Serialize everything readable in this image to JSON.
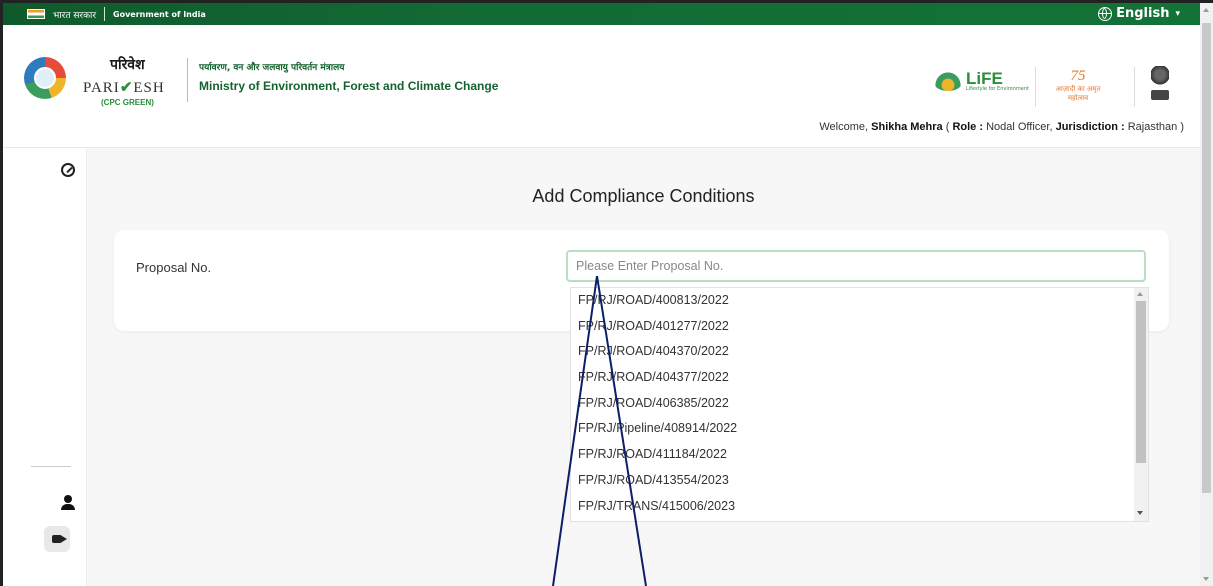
{
  "gov_bar": {
    "hindi": "भारत सरकार",
    "english": "Government of India",
    "language": "English"
  },
  "header": {
    "logo_hindi": "परिवेश",
    "logo_english_pre": "PARI",
    "logo_english_post": "ESH",
    "logo_sub": "(CPC GREEN)",
    "ministry_hindi": "पर्यावरण, वन और जलवायु परिवर्तन मंत्रालय",
    "ministry_english": "Ministry of Environment, Forest and Climate Change",
    "life_brand": "LiFE",
    "life_tagline": "Lifestyle for Environment",
    "azadi_number": "75",
    "azadi_text": "आज़ादी का अमृत महोत्सव",
    "welcome_prefix": "Welcome,",
    "user_name": "Shikha Mehra",
    "role_label": "Role :",
    "role_value": "Nodal Officer,",
    "jurisdiction_label": "Jurisdiction :",
    "jurisdiction_value": "Rajasthan"
  },
  "main": {
    "title": "Add Compliance Conditions",
    "proposal_label": "Proposal No.",
    "proposal_placeholder": "Please Enter Proposal No.",
    "proposal_value": "",
    "dropdown_items": [
      "FP/RJ/ROAD/400813/2022",
      "FP/RJ/ROAD/401277/2022",
      "FP/RJ/ROAD/404370/2022",
      "FP/RJ/ROAD/404377/2022",
      "FP/RJ/ROAD/406385/2022",
      "FP/RJ/Pipeline/408914/2022",
      "FP/RJ/ROAD/411184/2022",
      "FP/RJ/ROAD/413554/2023",
      "FP/RJ/TRANS/415006/2023"
    ]
  },
  "colors": {
    "gov_bar": "#136b35",
    "ministry_text": "#14632f",
    "input_border": "#b9dfc3"
  },
  "icons": [
    "globe-icon",
    "dashboard-icon",
    "user-icon",
    "logout-icon"
  ]
}
